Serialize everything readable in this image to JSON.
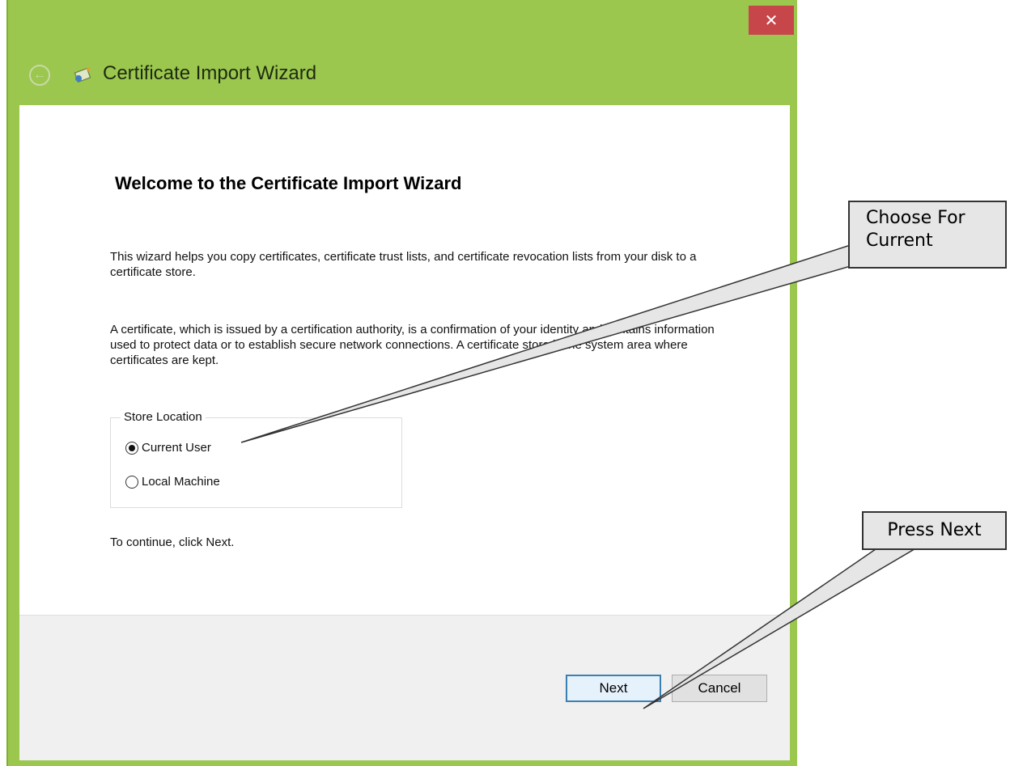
{
  "window": {
    "title": "Certificate Import Wizard",
    "close_label": "✕",
    "back_icon": "back-arrow-icon",
    "accent_color": "#9bc74f"
  },
  "content": {
    "heading": "Welcome to the Certificate Import Wizard",
    "paragraph1": "This wizard helps you copy certificates, certificate trust lists, and certificate revocation lists from your disk to a certificate store.",
    "paragraph2": "A certificate, which is issued by a certification authority, is a confirmation of your identity and contains information used to protect data or to establish secure network connections. A certificate store is the system area where certificates are kept.",
    "store_location": {
      "legend": "Store Location",
      "options": [
        {
          "label": "Current User",
          "selected": true
        },
        {
          "label": "Local Machine",
          "selected": false
        }
      ]
    },
    "continue_text": "To continue, click Next."
  },
  "footer": {
    "next_label": "Next",
    "cancel_label": "Cancel"
  },
  "callouts": {
    "current": "Choose For Current",
    "next": "Press Next"
  }
}
